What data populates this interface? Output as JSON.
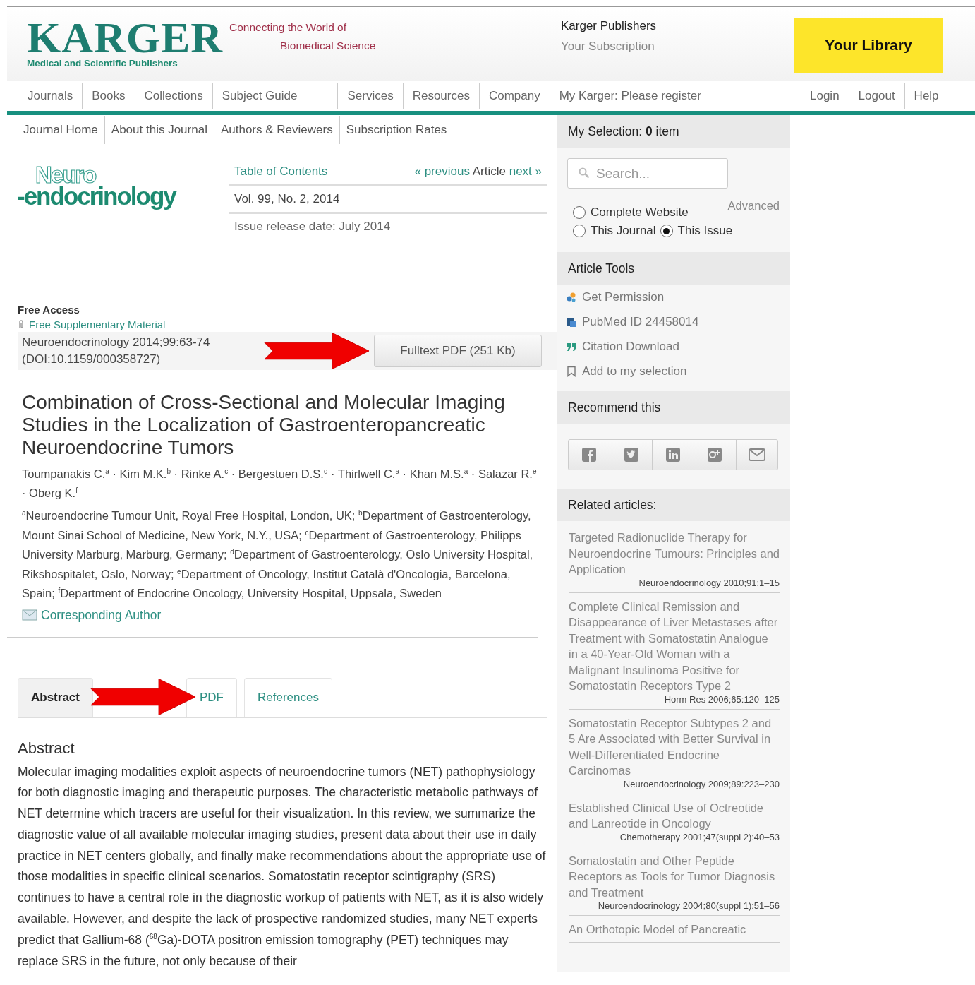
{
  "header": {
    "logo": {
      "wordmark": "KARGER",
      "tagline": "Medical and Scientific Publishers"
    },
    "slogan": [
      "Connecting the World of",
      "Biomedical Science"
    ],
    "publisher": "Karger Publishers",
    "subscription": "Your Subscription",
    "library_button": "Your Library"
  },
  "main_nav": {
    "items": [
      "Journals",
      "Books",
      "Collections",
      "Subject Guide",
      "Services",
      "Resources",
      "Company",
      "My Karger: Please register"
    ],
    "account_items": [
      "Login",
      "Logout",
      "Help"
    ]
  },
  "journal_nav": [
    "Journal Home",
    "About this Journal",
    "Authors & Reviewers",
    "Subscription Rates"
  ],
  "journal_logo": {
    "top": "Neuro",
    "bottom": "-endocrinology"
  },
  "issue": {
    "toc_link": "Table of Contents",
    "previous": "« previous",
    "article": "Article",
    "next": "next »",
    "volume": "Vol. 99, No. 2, 2014",
    "release": "Issue release date: July 2014"
  },
  "access": {
    "label": "Free Access",
    "supplementary": "Free Supplementary Material",
    "citation": [
      "Neuroendocrinology 2014;99:63-74",
      "(DOI:10.1159/000358727)"
    ],
    "fulltext_button": "Fulltext PDF (251 Kb)"
  },
  "article": {
    "title": "Combination of Cross-Sectional and Molecular Imaging Studies in the Localization of Gastroenteropancreatic Neuroendocrine Tumors",
    "authors": "Toumpanakis C.$^{a}$ · Kim M.K.$^{b}$ · Rinke A.$^{c}$ · Bergestuen D.S.$^{d}$ · Thirlwell C.$^{a}$ · Khan M.S.$^{a}$ · Salazar R.$^{e}$ · Oberg K.$^{f}$",
    "affiliations": "$^{a}$Neuroendocrine Tumour Unit, Royal Free Hospital, London, UK; $^{b}$Department of Gastroenterology, Mount Sinai School of Medicine, New York, N.Y., USA; $^{c}$Department of Gastroenterology, Philipps University Marburg, Marburg, Germany; $^{d}$Department of Gastroenterology, Oslo University Hospital, Rikshospitalet, Oslo, Norway; $^{e}$Department of Oncology, Institut Català d'Oncologia, Barcelona, Spain; $^{f}$Department of Endocrine Oncology, University Hospital, Uppsala, Sweden",
    "corresponding": "Corresponding Author"
  },
  "tabs": [
    {
      "label": "Abstract",
      "selected": true
    },
    {
      "label": "PDF",
      "selected": false
    },
    {
      "label": "References",
      "selected": false
    }
  ],
  "abstract": {
    "heading": "Abstract",
    "text": "Molecular imaging modalities exploit aspects of neuroendocrine tumors (NET) pathophysiology for both diagnostic imaging and therapeutic purposes. The characteristic metabolic pathways of NET determine which tracers are useful for their visualization. In this review, we summarize the diagnostic value of all available molecular imaging studies, present data about their use in daily practice in NET centers globally, and finally make recommendations about the appropriate use of those modalities in specific clinical scenarios. Somatostatin receptor scintigraphy (SRS) continues to have a central role in the diagnostic workup of patients with NET, as it is also widely available. However, and despite the lack of prospective randomized studies, many NET experts predict that Gallium-68 ($^{68}$Ga)-DOTA positron emission tomography (PET) techniques may replace SRS in the future, not only because of their"
  },
  "sidebar": {
    "selection": "My Selection: **0** item",
    "search_placeholder": "Search...",
    "advanced": "Advanced",
    "scopes": [
      {
        "label": "Complete Website",
        "selected": false
      },
      {
        "label": "This Journal",
        "selected": false
      },
      {
        "label": "This Issue",
        "selected": true
      }
    ],
    "tools_heading": "Article Tools",
    "tools": [
      {
        "label": "Get Permission",
        "kind": "permission"
      },
      {
        "label": "PubMed ID 24458014",
        "kind": "pubmed"
      },
      {
        "label": "Citation Download",
        "kind": "citation"
      },
      {
        "label": "Add to my selection",
        "kind": "bookmark"
      }
    ],
    "recommend_heading": "Recommend this",
    "related_heading": "Related articles:",
    "related": [
      {
        "title": "Targeted Radionuclide Therapy for Neuroendocrine Tumours: Principles and Application",
        "source": "Neuroendocrinology 2010;91:1–15"
      },
      {
        "title": "Complete Clinical Remission and Disappearance of Liver Metastases after Treatment with Somatostatin Analogue in a 40-Year-Old Woman with a Malignant Insulinoma Positive for Somatostatin Receptors Type 2",
        "source": "Horm Res 2006;65:120–125"
      },
      {
        "title": "Somatostatin Receptor Subtypes 2 and 5 Are Associated with Better Survival in Well-Differentiated Endocrine Carcinomas",
        "source": "Neuroendocrinology 2009;89:223–230"
      },
      {
        "title": "Established Clinical Use of Octreotide and Lanreotide in Oncology",
        "source": "Chemotherapy 2001;47(suppl 2):40–53"
      },
      {
        "title": "Somatostatin and Other Peptide Receptors as Tools for Tumor Diagnosis and Treatment",
        "source": "Neuroendocrinology 2004;80(suppl 1):51–56"
      },
      {
        "title": "An Orthotopic Model of Pancreatic"
      }
    ]
  }
}
